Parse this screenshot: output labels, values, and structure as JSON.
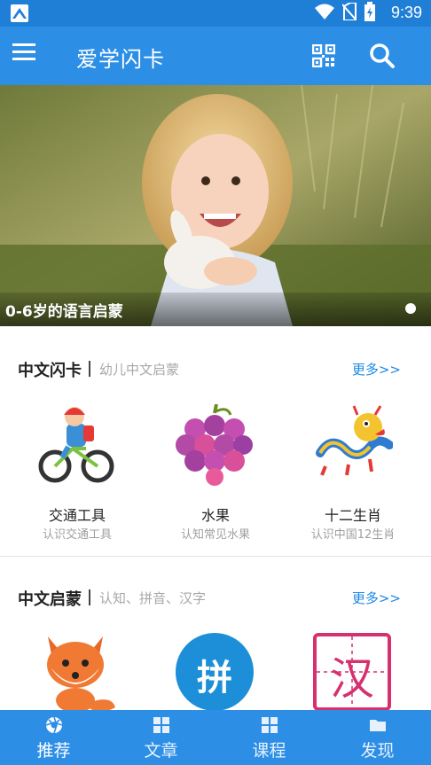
{
  "status_bar": {
    "time": "9:39"
  },
  "app_bar": {
    "title": "爱学闪卡",
    "menu_icon": "hamburger-menu-icon",
    "qr_icon": "qr-code-icon",
    "search_icon": "search-icon"
  },
  "banner": {
    "caption": "0-6岁的语言启蒙",
    "slides": 1,
    "active_slide": 1
  },
  "sections": [
    {
      "title": "中文闪卡",
      "subtitle": "幼儿中文启蒙",
      "more": "更多>>",
      "items": [
        {
          "name": "交通工具",
          "desc": "认识交通工具",
          "icon": "bicycle-kid-icon"
        },
        {
          "name": "水果",
          "desc": "认知常见水果",
          "icon": "grapes-icon"
        },
        {
          "name": "十二生肖",
          "desc": "认识中国12生肖",
          "icon": "dragon-icon"
        }
      ]
    },
    {
      "title": "中文启蒙",
      "subtitle": "认知、拼音、汉字",
      "more": "更多>>",
      "items": [
        {
          "name": "",
          "icon": "fox-icon"
        },
        {
          "name": "",
          "icon": "pinyin-badge-icon",
          "glyph": "拼"
        },
        {
          "name": "",
          "icon": "hanzi-grid-icon",
          "glyph": "汉"
        }
      ]
    }
  ],
  "bottom_nav": [
    {
      "label": "推荐",
      "icon": "aperture-icon",
      "active": true
    },
    {
      "label": "文章",
      "icon": "grid-icon",
      "active": false
    },
    {
      "label": "课程",
      "icon": "grid-icon",
      "active": false
    },
    {
      "label": "发现",
      "icon": "folder-icon",
      "active": false
    }
  ],
  "colors": {
    "primary": "#2d8ee6",
    "status_bar": "#1f7fd6",
    "link": "#1e88e5",
    "muted": "#a0a0a0"
  }
}
